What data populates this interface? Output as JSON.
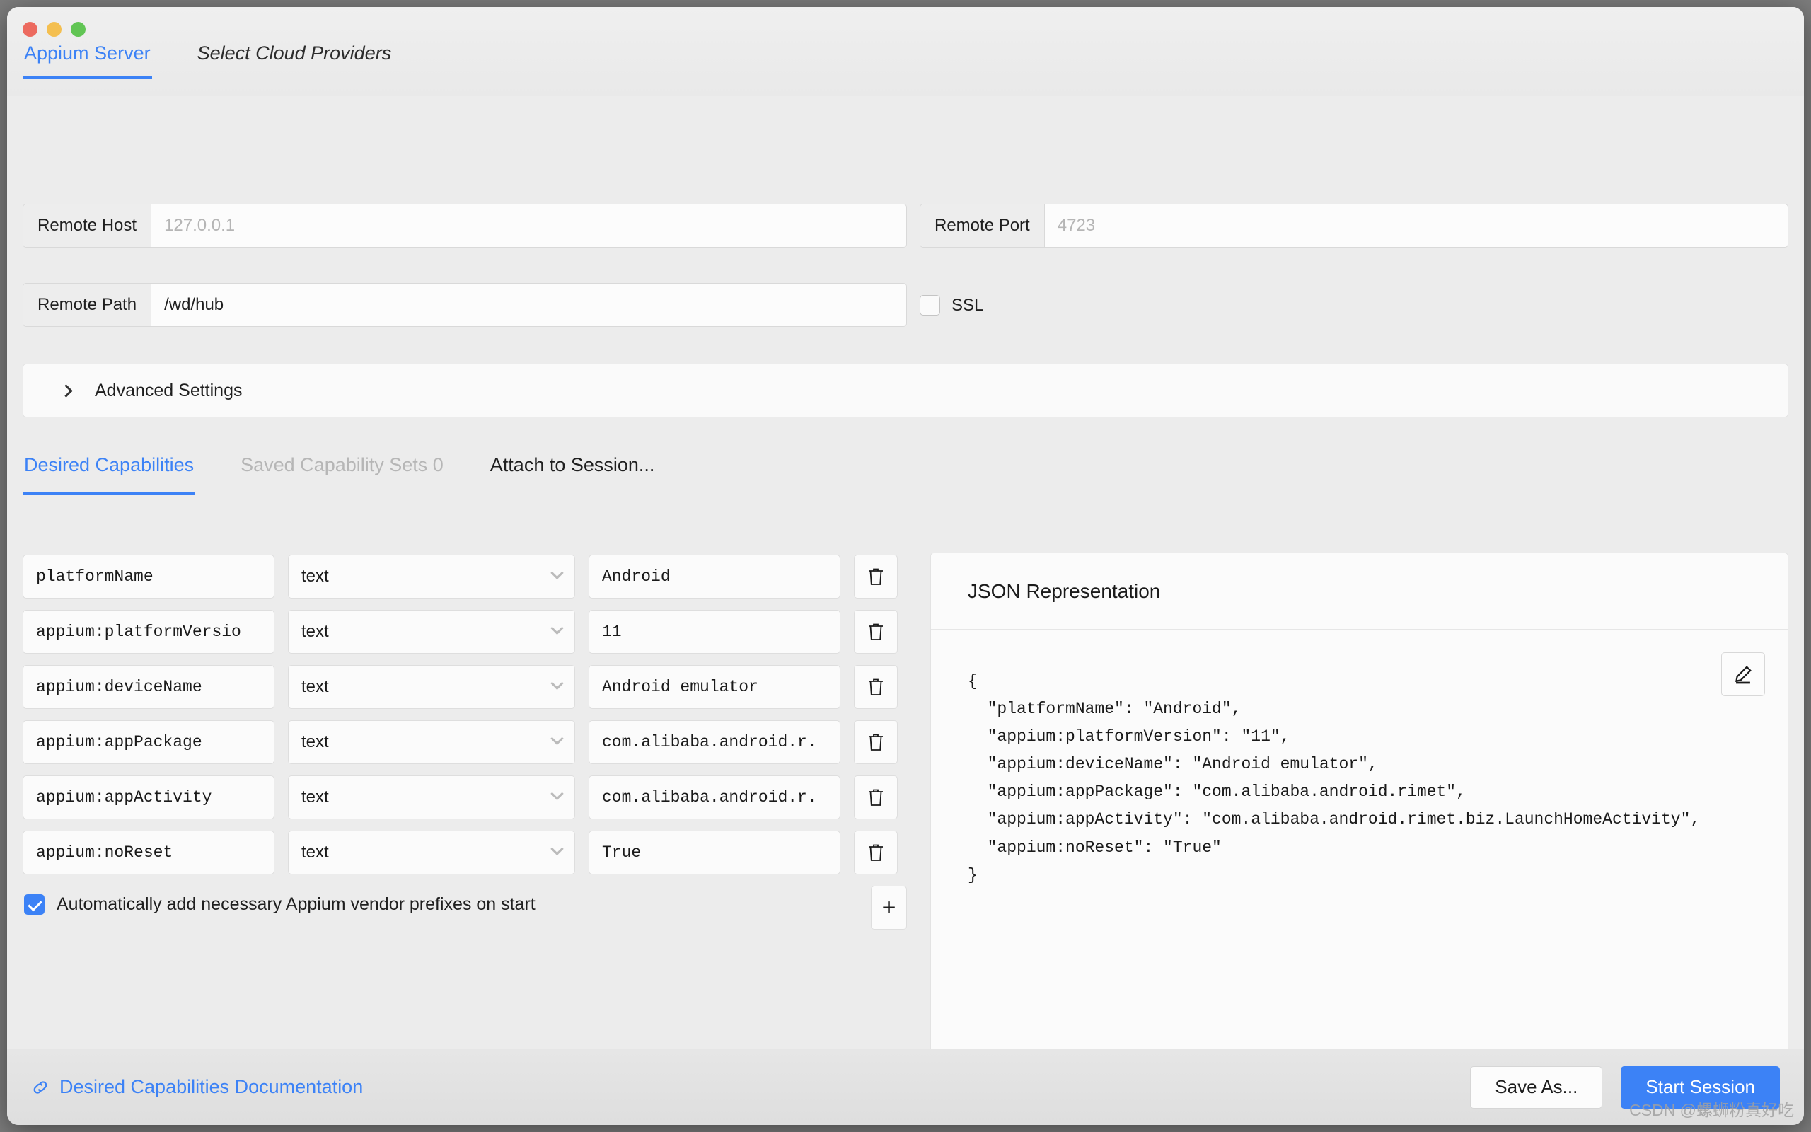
{
  "window": {
    "traffic_lights": [
      "close",
      "minimize",
      "zoom"
    ],
    "colors": {
      "accent": "#3c82f6",
      "red": "#ec6a5f",
      "yellow": "#f4bf50",
      "green": "#61c554"
    }
  },
  "top_tabs": [
    {
      "label": "Appium Server",
      "active": true
    },
    {
      "label": "Select Cloud Providers",
      "active": false
    }
  ],
  "server": {
    "remote_host": {
      "label": "Remote Host",
      "value": "",
      "placeholder": "127.0.0.1"
    },
    "remote_port": {
      "label": "Remote Port",
      "value": "",
      "placeholder": "4723"
    },
    "remote_path": {
      "label": "Remote Path",
      "value": "/wd/hub",
      "placeholder": "/wd/hub"
    },
    "ssl": {
      "label": "SSL",
      "checked": false
    },
    "advanced": {
      "label": "Advanced Settings",
      "expanded": false
    }
  },
  "tabs": [
    {
      "label": "Desired Capabilities",
      "active": true,
      "disabled": false
    },
    {
      "label": "Saved Capability Sets 0",
      "active": false,
      "disabled": true
    },
    {
      "label": "Attach to Session...",
      "active": false,
      "disabled": false
    }
  ],
  "capabilities": {
    "rows": [
      {
        "name": "platformName",
        "type": "text",
        "value": "Android"
      },
      {
        "name": "appium:platformVersio",
        "type": "text",
        "value": "11"
      },
      {
        "name": "appium:deviceName",
        "type": "text",
        "value": "Android emulator"
      },
      {
        "name": "appium:appPackage",
        "type": "text",
        "value": "com.alibaba.android.r."
      },
      {
        "name": "appium:appActivity",
        "type": "text",
        "value": "com.alibaba.android.r."
      },
      {
        "name": "appium:noReset",
        "type": "text",
        "value": "True"
      }
    ],
    "add_label": "+",
    "auto_prefix": {
      "label": "Automatically add necessary Appium vendor prefixes on start",
      "checked": true
    }
  },
  "json_panel": {
    "title": "JSON Representation",
    "code": "{\n  \"platformName\": \"Android\",\n  \"appium:platformVersion\": \"11\",\n  \"appium:deviceName\": \"Android emulator\",\n  \"appium:appPackage\": \"com.alibaba.android.rimet\",\n  \"appium:appActivity\": \"com.alibaba.android.rimet.biz.LaunchHomeActivity\",\n  \"appium:noReset\": \"True\"\n}"
  },
  "footer": {
    "doc_link": "Desired Capabilities Documentation",
    "save_as": "Save As...",
    "start_session": "Start Session"
  },
  "watermark": "CSDN @螺蛳粉真好吃"
}
